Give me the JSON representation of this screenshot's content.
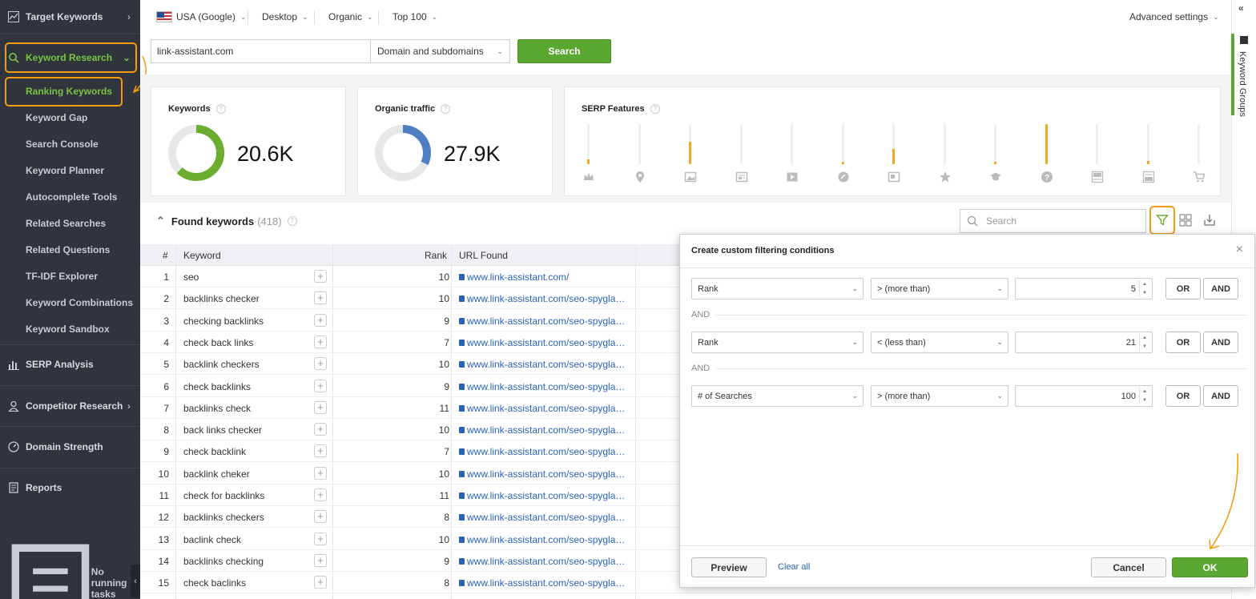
{
  "sidebar": {
    "target_keywords": "Target Keywords",
    "keyword_research": "Keyword Research",
    "sub_items": [
      "Ranking Keywords",
      "Keyword Gap",
      "Search Console",
      "Keyword Planner",
      "Autocomplete Tools",
      "Related Searches",
      "Related Questions",
      "TF-IDF Explorer",
      "Keyword Combinations",
      "Keyword Sandbox"
    ],
    "serp_analysis": "SERP Analysis",
    "competitor_research": "Competitor Research",
    "domain_strength": "Domain Strength",
    "reports": "Reports",
    "no_running_tasks": "No running tasks"
  },
  "topbar": {
    "region": "USA (Google)",
    "device": "Desktop",
    "result_type": "Organic",
    "depth": "Top 100",
    "advanced": "Advanced settings"
  },
  "search": {
    "domain": "link-assistant.com",
    "scope": "Domain and subdomains",
    "button": "Search"
  },
  "stats": {
    "keywords_label": "Keywords",
    "keywords_value": "20.6K",
    "keywords_fraction": 0.62,
    "traffic_label": "Organic traffic",
    "traffic_value": "27.9K",
    "traffic_fraction": 0.32,
    "serp_label": "SERP Features",
    "serp_features": [
      {
        "icon": "crown-icon",
        "level": 0.12
      },
      {
        "icon": "map-pin-icon",
        "level": 0
      },
      {
        "icon": "image-icon",
        "level": 0.55
      },
      {
        "icon": "news-icon",
        "level": 0
      },
      {
        "icon": "video-icon",
        "level": 0
      },
      {
        "icon": "link-icon",
        "level": 0.05
      },
      {
        "icon": "snippet-icon",
        "level": 0.38
      },
      {
        "icon": "star-icon",
        "level": 0
      },
      {
        "icon": "education-icon",
        "level": 0.05
      },
      {
        "icon": "question-icon",
        "level": 1.0
      },
      {
        "icon": "ad-top-icon",
        "level": 0
      },
      {
        "icon": "ad-bottom-icon",
        "level": 0.07
      },
      {
        "icon": "cart-icon",
        "level": 0
      }
    ],
    "accent_color": "#6aad2f",
    "traffic_color": "#4f7fc2",
    "bar_color": "#f5a623"
  },
  "found": {
    "title": "Found keywords",
    "count": "(418)",
    "search_placeholder": "Search"
  },
  "table": {
    "headers": {
      "num": "#",
      "keyword": "Keyword",
      "rank": "Rank",
      "url": "URL Found"
    },
    "rows": [
      {
        "num": "1",
        "keyword": "seo",
        "rank": "10",
        "url": "www.link-assistant.com/"
      },
      {
        "num": "2",
        "keyword": "backlinks checker",
        "rank": "10",
        "url": "www.link-assistant.com/seo-spyglass/free-backlink-checker/"
      },
      {
        "num": "3",
        "keyword": "checking backlinks",
        "rank": "9",
        "url": "www.link-assistant.com/seo-spyglass/free-backlink-checker/"
      },
      {
        "num": "4",
        "keyword": "check back links",
        "rank": "7",
        "url": "www.link-assistant.com/seo-spyglass/free-backlink-checker/"
      },
      {
        "num": "5",
        "keyword": "backlink checkers",
        "rank": "10",
        "url": "www.link-assistant.com/seo-spyglass/free-backlink-checker/"
      },
      {
        "num": "6",
        "keyword": "check backlinks",
        "rank": "9",
        "url": "www.link-assistant.com/seo-spyglass/free-backlink-checker/"
      },
      {
        "num": "7",
        "keyword": "backlinks check",
        "rank": "11",
        "url": "www.link-assistant.com/seo-spyglass/free-backlink-checker/"
      },
      {
        "num": "8",
        "keyword": "back links checker",
        "rank": "10",
        "url": "www.link-assistant.com/seo-spyglass/free-backlink-checker/"
      },
      {
        "num": "9",
        "keyword": "check backlink",
        "rank": "7",
        "url": "www.link-assistant.com/seo-spyglass/free-backlink-checker/"
      },
      {
        "num": "10",
        "keyword": "backlink cheker",
        "rank": "10",
        "url": "www.link-assistant.com/seo-spyglass/free-backlink-checker/"
      },
      {
        "num": "11",
        "keyword": "check for backlinks",
        "rank": "11",
        "url": "www.link-assistant.com/seo-spyglass/free-backlink-checker/"
      },
      {
        "num": "12",
        "keyword": "backlinks checkers",
        "rank": "8",
        "url": "www.link-assistant.com/seo-spyglass/free-backlink-checker/"
      },
      {
        "num": "13",
        "keyword": "baclink check",
        "rank": "10",
        "url": "www.link-assistant.com/seo-spyglass/free-backlink-checker/"
      },
      {
        "num": "14",
        "keyword": "backlinks checking",
        "rank": "9",
        "url": "www.link-assistant.com/seo-spyglass/free-backlink-checker/"
      },
      {
        "num": "15",
        "keyword": "check baclinks",
        "rank": "8",
        "url": "www.link-assistant.com/seo-spyglass/free-backlink-checker/"
      }
    ]
  },
  "right_panel": {
    "label": "Keyword Groups",
    "collapse": "«"
  },
  "dialog": {
    "title": "Create custom filtering conditions",
    "close": "×",
    "joiner": "AND",
    "conditions": [
      {
        "field": "Rank",
        "operator": "> (more than)",
        "value": "5"
      },
      {
        "field": "Rank",
        "operator": "< (less than)",
        "value": "21"
      },
      {
        "field": "# of Searches",
        "operator": "> (more than)",
        "value": "100"
      }
    ],
    "or_label": "OR",
    "and_label": "AND",
    "preview": "Preview",
    "clear_all": "Clear all",
    "cancel": "Cancel",
    "ok": "OK"
  }
}
